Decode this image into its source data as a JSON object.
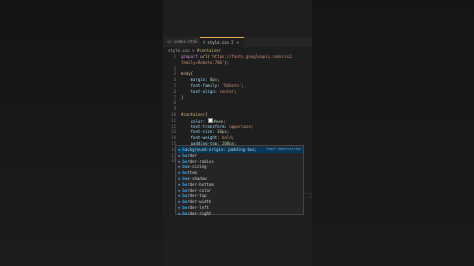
{
  "tabs": [
    {
      "icon": "html-file-icon",
      "label": "index.html",
      "active": false
    },
    {
      "icon": "css-file-icon",
      "label": "style.css",
      "active": true,
      "modified": "2",
      "close": "×"
    }
  ],
  "breadcrumb": {
    "file": "style.css",
    "separator": ">",
    "symbol": "#container"
  },
  "code": {
    "lines": [
      {
        "n": "1",
        "html": "<span class='kw'>@import</span> <span class='fn'>url</span><span class='punc'>(</span><span class='str'>'https://fonts.googleapis.com/css2</span>"
      },
      {
        "n": "",
        "html": "<span class='str'>family=Roboto:700'</span><span class='punc'>);</span>"
      },
      {
        "n": "2",
        "html": ""
      },
      {
        "n": "3",
        "html": "<span class='sel'>body</span><span class='punc'>{</span>"
      },
      {
        "n": "4",
        "html": "    <span class='prop'>margin</span><span class='punc'>:</span> <span class='num'>0px</span><span class='punc'>;</span>"
      },
      {
        "n": "5",
        "html": "    <span class='prop'>font-family</span><span class='punc'>:</span> <span class='str'>'Roboto'</span><span class='punc'>;</span>"
      },
      {
        "n": "6",
        "html": "    <span class='prop'>text-align</span><span class='punc'>:</span> <span class='str'>center</span><span class='punc'>;</span>"
      },
      {
        "n": "7",
        "html": "<span class='punc'>}</span>"
      },
      {
        "n": "8",
        "html": ""
      },
      {
        "n": "9",
        "html": ""
      },
      {
        "n": "10",
        "html": "<span class='sel'>#container</span><span class='punc'>{</span>"
      },
      {
        "n": "11",
        "html": "    <span class='prop'>color</span><span class='punc'>:</span> <span class='swatch' style='background:#eeeeee'></span><span class='num'>#eee</span><span class='punc'>;</span>"
      },
      {
        "n": "12",
        "html": "    <span class='prop'>text-transform</span><span class='punc'>:</span> <span class='str'>uppercase</span><span class='punc'>;</span>"
      },
      {
        "n": "13",
        "html": "    <span class='prop'>font-size</span><span class='punc'>:</span> <span class='num'>36px</span><span class='punc'>;</span>"
      },
      {
        "n": "14",
        "html": "    <span class='prop'>font-weight</span><span class='punc'>:</span> <span class='str'>bold</span><span class='punc'>;</span>"
      },
      {
        "n": "15",
        "html": "    <span class='prop'>padding-top</span><span class='punc'>:</span> <span class='num'>200px</span><span class='punc'>;</span>"
      },
      {
        "n": "16",
        "html": "    <span class='prop'>position</span><span class='punc'>:</span> <span class='str'>fixed</span><span class='punc'>;</span>"
      },
      {
        "n": "17",
        "html": "    <span class='prop'>bo</span>"
      },
      {
        "n": "18",
        "html": ""
      }
    ]
  },
  "suggestions": {
    "items": [
      {
        "match": "b",
        "rest": "ackground-origin: padding-box;",
        "detail": "Emmet Abbreviation",
        "selected": true
      },
      {
        "match": "bo",
        "rest": "rder",
        "selected": false
      },
      {
        "match": "bo",
        "rest": "rder-radius",
        "selected": false
      },
      {
        "match": "bo",
        "rest": "x-sizing",
        "selected": false
      },
      {
        "match": "bo",
        "rest": "ttom",
        "selected": false
      },
      {
        "match": "bo",
        "rest": "x-shadow",
        "selected": false
      },
      {
        "match": "bo",
        "rest": "rder-bottom",
        "selected": false
      },
      {
        "match": "bo",
        "rest": "rder-color",
        "selected": false
      },
      {
        "match": "bo",
        "rest": "rder-top",
        "selected": false
      },
      {
        "match": "bo",
        "rest": "rder-width",
        "selected": false
      },
      {
        "match": "bo",
        "rest": "rder-left",
        "selected": false
      },
      {
        "match": "bo",
        "rest": "rder-right",
        "selected": false
      }
    ]
  }
}
